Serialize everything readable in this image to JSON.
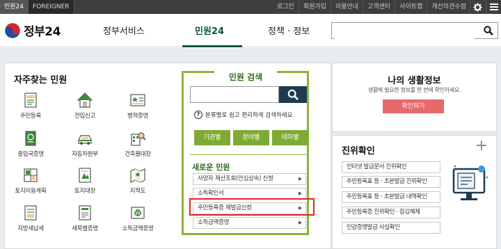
{
  "topbar": {
    "tabs": [
      {
        "label": "민원24"
      },
      {
        "label": "FOREIGNER"
      }
    ],
    "links": [
      "로그인",
      "회원가입",
      "이용안내",
      "고객센터",
      "사이트맵",
      "개선의견수렴"
    ]
  },
  "header": {
    "logo_text": "정부24",
    "nav": [
      "정부서비스",
      "민원24",
      "정책 · 정보"
    ],
    "search_value": ""
  },
  "frequent": {
    "title": "자주찾는 민원",
    "items": [
      {
        "label": "주민등록",
        "icon": "resident-registration-icon"
      },
      {
        "label": "전입신고",
        "icon": "house-icon"
      },
      {
        "label": "병적증명",
        "icon": "military-record-icon"
      },
      {
        "label": "출입국증명",
        "icon": "passport-icon"
      },
      {
        "label": "자동차원부",
        "icon": "car-icon"
      },
      {
        "label": "건축물대장",
        "icon": "building-search-icon"
      },
      {
        "label": "토지이용계획",
        "icon": "land-use-icon"
      },
      {
        "label": "토지대장",
        "icon": "land-ledger-icon"
      },
      {
        "label": "지적도",
        "icon": "cadastral-map-icon"
      },
      {
        "label": "지방세납세",
        "icon": "local-tax-icon"
      },
      {
        "label": "세목별증명",
        "icon": "tax-item-icon"
      },
      {
        "label": "소득금액증명",
        "icon": "income-certificate-icon"
      }
    ]
  },
  "civil_search": {
    "title": "민원 검색",
    "input_value": "",
    "hint": "분류별로 쉽고 편리하게 검색하세요",
    "tabs": [
      "기관별",
      "분야별",
      "테마별"
    ],
    "new_title": "새로운 민원",
    "new_items": [
      "사망자 재산조회(안심상속) 신청",
      "소득확인서",
      "주민등록증 재발급신청",
      "소득금액증명"
    ]
  },
  "life_info": {
    "title": "나의 생활정보",
    "subtitle": "생활에 필요한 정보를 한 번에 확인하세요.",
    "button": "확인하기"
  },
  "verification": {
    "title": "진위확인",
    "items": [
      "인터넷 발급문서 진위확인",
      "주민등록표 등 · 초본발급 진위확인",
      "주민등록표 등 · 초본발급 내역확인",
      "주민등록증 진위확인 · 잠김해제",
      "인감증명발급 사실확인"
    ]
  },
  "colors": {
    "accent_green": "#8ab33a",
    "nav_active": "#0b5640",
    "search_button": "#1e3a52",
    "life_button": "#e8696a",
    "highlight": "#e0251c"
  }
}
